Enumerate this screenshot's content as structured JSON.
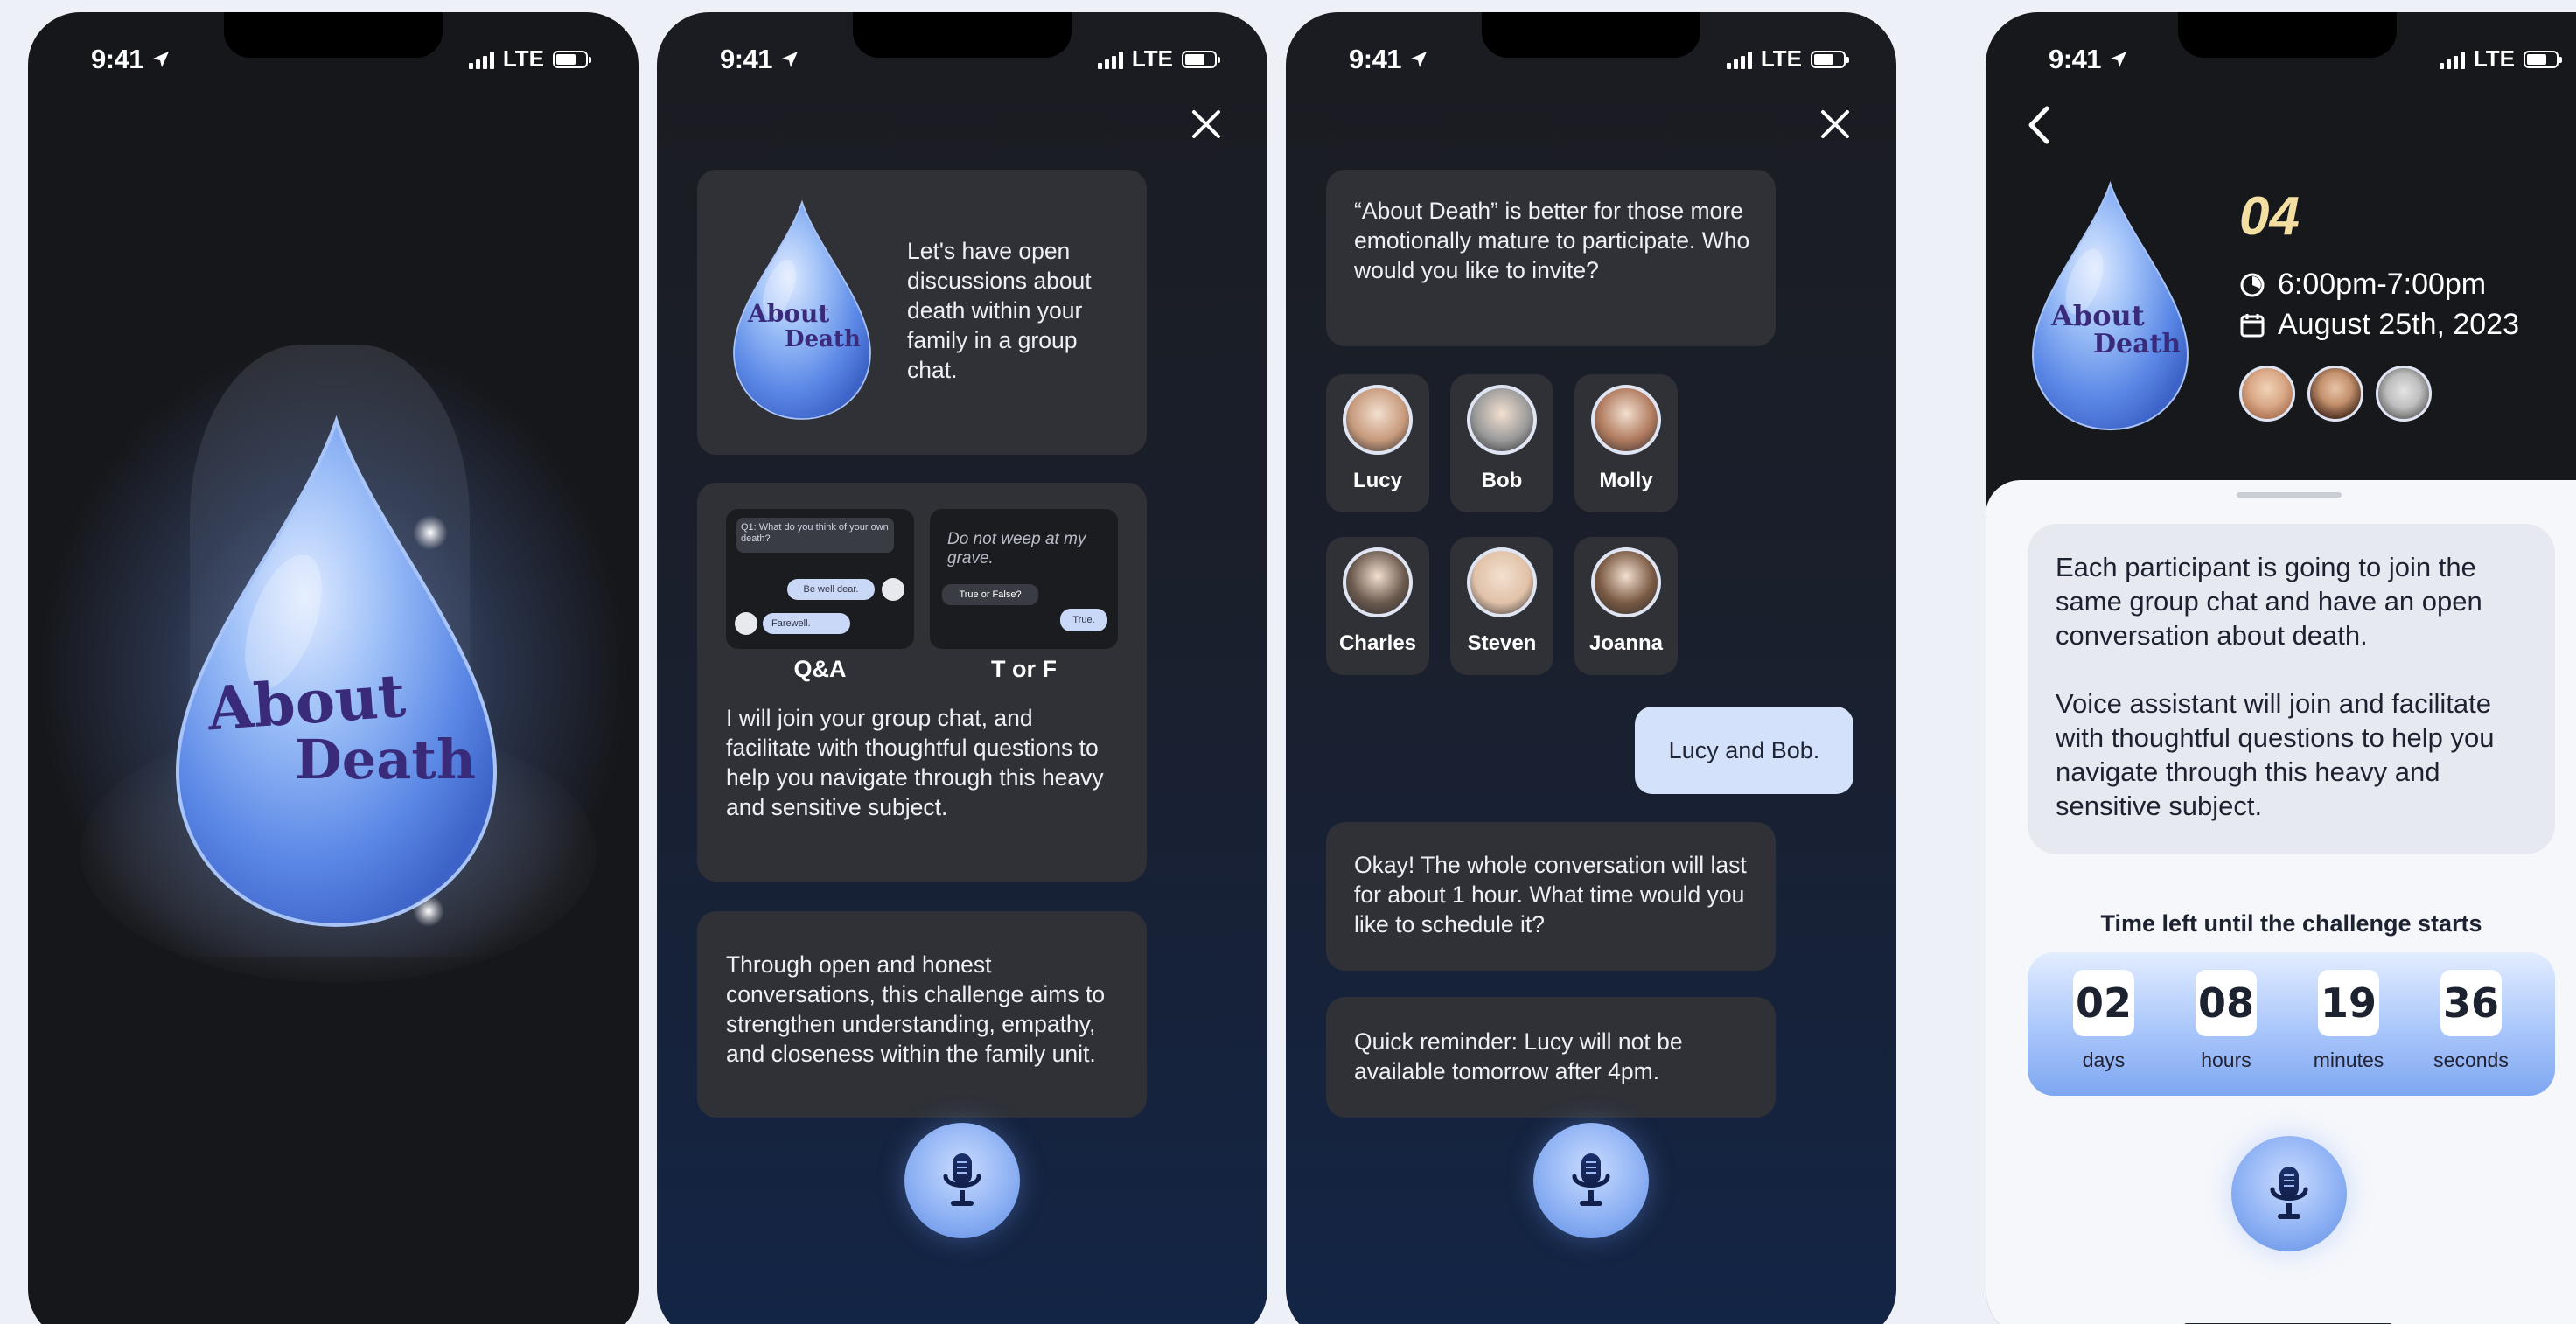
{
  "status": {
    "time": "9:41",
    "network": "LTE"
  },
  "screen1": {
    "logo_line1": "About",
    "logo_line2": "Death"
  },
  "screen2": {
    "intro_text": "Let's have open discussions about death within your family in a group chat.",
    "logo_line1": "About",
    "logo_line2": "Death",
    "qa_preview": {
      "question": "Q1: What do you think of your own death?",
      "bubble1": "Be well dear.",
      "bubble2": "Farewell."
    },
    "tf_preview": {
      "quote": "Do not weep at my grave.",
      "prompt": "True or False?",
      "answer": "True."
    },
    "mode1_label": "Q&A",
    "mode2_label": "T or F",
    "feature_text": "I will join your group chat, and facilitate with thoughtful questions to help you navigate through this heavy and sensitive subject.",
    "goal_text": "Through open and honest conversations, this challenge aims to strengthen understanding, empathy, and closeness within the family unit."
  },
  "screen3": {
    "assistant_msg1": "“About Death” is better for those more emotionally mature to participate. Who would you like to invite?",
    "contacts": [
      {
        "name": "Lucy",
        "color": "#c79a7c"
      },
      {
        "name": "Bob",
        "color": "#9a9a9a"
      },
      {
        "name": "Molly",
        "color": "#b07a5e"
      },
      {
        "name": "Charles",
        "color": "#6b5a4e"
      },
      {
        "name": "Steven",
        "color": "#e1c2a8"
      },
      {
        "name": "Joanna",
        "color": "#7a5a44"
      }
    ],
    "user_msg": "Lucy and Bob.",
    "assistant_msg2": "Okay! The whole conversation will last for about 1 hour. What time would you like to schedule it?",
    "assistant_msg3": "Quick reminder: Lucy will not be available tomorrow after 4pm."
  },
  "screen4": {
    "number": "04",
    "time_range": "6:00pm-7:00pm",
    "date": "August 25th, 2023",
    "logo_line1": "About",
    "logo_line2": "Death",
    "description1": "Each participant is going to join the same group chat and have an open conversation about death.",
    "description2": "Voice assistant will join and facilitate with thoughtful questions to help you navigate through this heavy and sensitive subject.",
    "countdown_title": "Time left until the challenge starts",
    "countdown": [
      {
        "value": "02",
        "unit": "days"
      },
      {
        "value": "08",
        "unit": "hours"
      },
      {
        "value": "19",
        "unit": "minutes"
      },
      {
        "value": "36",
        "unit": "seconds"
      }
    ]
  },
  "colors": {
    "accent": "#7ea6f0",
    "card": "#2f3137",
    "sheet": "#ffffff",
    "number": "#f3dfa2"
  },
  "icons": [
    "location-arrow-icon",
    "signal-icon",
    "battery-icon",
    "close-icon",
    "microphone-icon",
    "back-chevron-icon",
    "clock-icon",
    "calendar-icon"
  ]
}
